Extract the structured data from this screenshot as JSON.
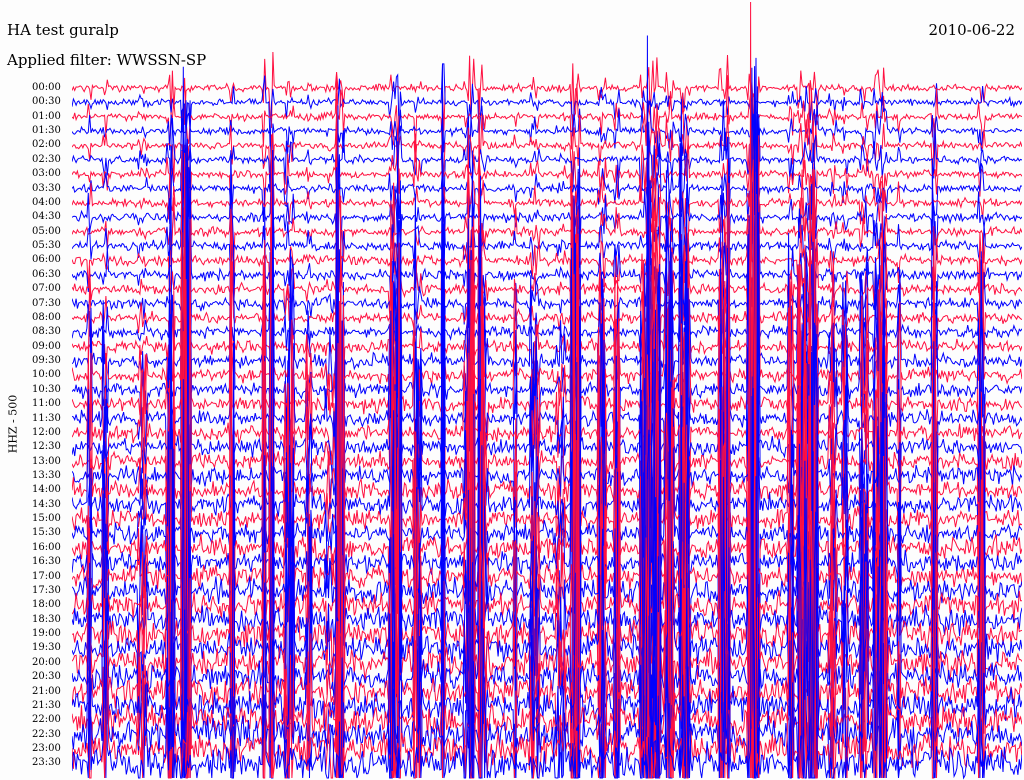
{
  "header": {
    "title": "HA test guralp",
    "filter": "Applied filter: WWSSN-SP",
    "date": "2010-06-22"
  },
  "chart_data": {
    "type": "line",
    "title": "HA test guralp",
    "subtitle": "Applied filter: WWSSN-SP",
    "ylabel": "HHZ - 500",
    "xlabel": "",
    "grid": false,
    "legend": "none",
    "colors": [
      "#ff1040",
      "#0000ff"
    ],
    "row_labels": [
      "00:00",
      "00:30",
      "01:00",
      "01:30",
      "02:00",
      "02:30",
      "03:00",
      "03:30",
      "04:00",
      "04:30",
      "05:00",
      "05:30",
      "06:00",
      "06:30",
      "07:00",
      "07:30",
      "08:00",
      "08:30",
      "09:00",
      "09:30",
      "10:00",
      "10:30",
      "11:00",
      "11:30",
      "12:00",
      "12:30",
      "13:00",
      "13:30",
      "14:00",
      "14:30",
      "15:00",
      "15:30",
      "16:00",
      "16:30",
      "17:00",
      "17:30",
      "18:00",
      "18:30",
      "19:00",
      "19:30",
      "20:00",
      "20:30",
      "21:00",
      "21:30",
      "22:00",
      "22:30",
      "23:00",
      "23:30"
    ],
    "activity": [
      0.6,
      0.6,
      0.62,
      0.65,
      0.7,
      0.75,
      0.8,
      0.85,
      0.9,
      0.95,
      1.0,
      1.0,
      1.0,
      1.0,
      1.0,
      1.0,
      1.0,
      1.0,
      1.0,
      1.0,
      1.0,
      1.0,
      1.0,
      1.0,
      1.0,
      1.0,
      1.0,
      1.0,
      1.0,
      1.0,
      1.0,
      1.0,
      1.0,
      1.0,
      1.0,
      1.0,
      1.0,
      1.0,
      1.0,
      1.0,
      1.0,
      1.0,
      1.0,
      1.0,
      1.0,
      1.0,
      1.0,
      1.0
    ]
  }
}
